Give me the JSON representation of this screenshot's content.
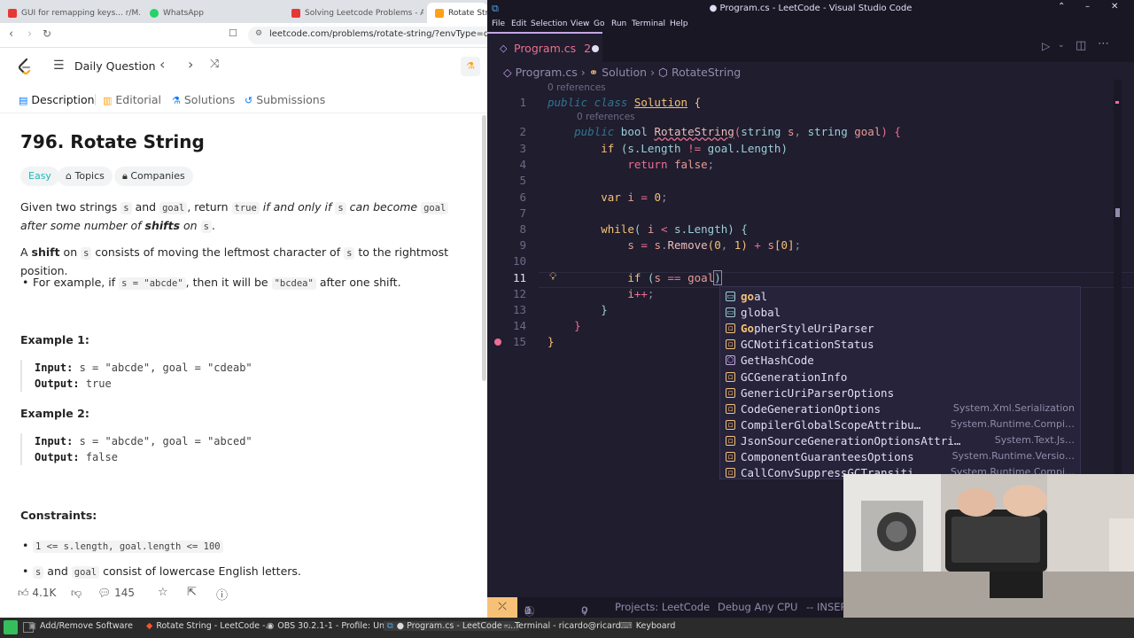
{
  "browser": {
    "tabs": [
      {
        "label": "GUI for remapping keys... r/M...",
        "color": "#e53935"
      },
      {
        "label": "WhatsApp",
        "color": "#25d366"
      },
      {
        "label": "Solving Leetcode Problems - A...",
        "color": "#e53935"
      },
      {
        "label": "Rotate String",
        "color": "#ffa116"
      }
    ],
    "url": "leetcode.com/problems/rotate-string/?envType=daily-q",
    "header": {
      "daily": "Daily Question"
    },
    "nav": [
      "Description",
      "Editorial",
      "Solutions",
      "Submissions"
    ],
    "problem": {
      "title": "796. Rotate String",
      "difficulty": "Easy",
      "topics": "Topics",
      "companies": "Companies",
      "p1": [
        "Given two strings ",
        "s",
        " and ",
        "goal",
        ", return ",
        "true",
        " if and only if ",
        "s",
        " can become ",
        "goal",
        " after some number of ",
        "shifts",
        " on ",
        "s",
        "."
      ],
      "p2": [
        "A ",
        "shift",
        " on ",
        "s",
        " consists of moving the leftmost character of ",
        "s",
        " to the rightmost position."
      ],
      "bullet": [
        "For example, if ",
        "s = \"abcde\"",
        ", then it will be ",
        "\"bcdea\"",
        " after one shift."
      ],
      "ex1_title": "Example 1:",
      "ex1_input_label": "Input:",
      "ex1_input": "s = \"abcde\", goal = \"cdeab\"",
      "ex1_output_label": "Output:",
      "ex1_output": "true",
      "ex2_title": "Example 2:",
      "ex2_input_label": "Input:",
      "ex2_input": "s = \"abcde\", goal = \"abced\"",
      "ex2_output_label": "Output:",
      "ex2_output": "false",
      "constraints_title": "Constraints:",
      "c1": "1 <= s.length, goal.length <= 100",
      "c2": [
        "s",
        " and ",
        "goal",
        " consist of lowercase English letters."
      ]
    },
    "actions": {
      "likes": "4.1K",
      "comments": "145"
    }
  },
  "vscode": {
    "title": "● Program.cs - LeetCode - Visual Studio Code",
    "menu": [
      "File",
      "Edit",
      "Selection",
      "View",
      "Go",
      "Run",
      "Terminal",
      "Help"
    ],
    "tab": {
      "label": "Program.cs",
      "badge": "2"
    },
    "breadcrumb": [
      "Program.cs",
      "Solution",
      "RotateString"
    ],
    "codelens": "0 references",
    "line_numbers": [
      "1",
      "2",
      "3",
      "4",
      "5",
      "6",
      "7",
      "8",
      "9",
      "10",
      "11",
      "12",
      "13",
      "14",
      "15"
    ],
    "suggestions": [
      {
        "icon": "snippet",
        "label": "goal",
        "detail": ""
      },
      {
        "icon": "snippet",
        "label": "global",
        "detail": ""
      },
      {
        "icon": "class",
        "label": "GopherStyleUriParser",
        "detail": ""
      },
      {
        "icon": "class",
        "label": "GCNotificationStatus",
        "detail": ""
      },
      {
        "icon": "method",
        "label": "GetHashCode",
        "detail": ""
      },
      {
        "icon": "class",
        "label": "GCGenerationInfo",
        "detail": ""
      },
      {
        "icon": "class",
        "label": "GenericUriParserOptions",
        "detail": ""
      },
      {
        "icon": "class",
        "label": "CodeGenerationOptions",
        "detail": "System.Xml.Serialization"
      },
      {
        "icon": "class",
        "label": "CompilerGlobalScopeAttribu…",
        "detail": "System.Runtime.Compi…"
      },
      {
        "icon": "class",
        "label": "JsonSourceGenerationOptionsAttri…",
        "detail": "System.Text.Js…"
      },
      {
        "icon": "class",
        "label": "ComponentGuaranteesOptions",
        "detail": "System.Runtime.Versio…"
      },
      {
        "icon": "class",
        "label": "CallConvSuppressGCTransiti…",
        "detail": "System.Runtime.Compi…"
      }
    ],
    "status": {
      "errors": "1",
      "warnings": "0",
      "ports": "0",
      "project": "Projects: LeetCode",
      "config": "Debug Any CPU",
      "mode": "-- INSERT --"
    }
  },
  "taskbar": [
    {
      "label": "Add/Remove Software"
    },
    {
      "label": "Rotate String - LeetCode -..."
    },
    {
      "label": "OBS 30.2.1-1 - Profile: Un..."
    },
    {
      "label": "● Program.cs - LeetCode -..."
    },
    {
      "label": "Terminal - ricardo@ricard..."
    },
    {
      "label": "Keyboard"
    }
  ]
}
